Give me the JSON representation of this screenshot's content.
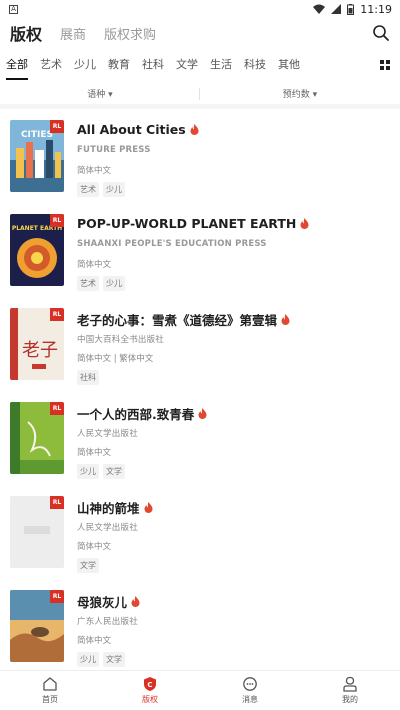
{
  "status_bar": {
    "notification": "A",
    "time": "11:19"
  },
  "top_tabs": [
    {
      "label": "版权",
      "active": true
    },
    {
      "label": "展商",
      "active": false
    },
    {
      "label": "版权求购",
      "active": false
    }
  ],
  "categories": [
    "全部",
    "艺术",
    "少儿",
    "教育",
    "社科",
    "文学",
    "生活",
    "科技",
    "其他"
  ],
  "active_category": "全部",
  "filters": [
    {
      "label": "语种 ▾"
    },
    {
      "label": "预约数 ▾"
    }
  ],
  "badge_text": "RL",
  "books": [
    {
      "title": "All About Cities",
      "publisher": "FUTURE PRESS",
      "lang": "简体中文",
      "tags": [
        "艺术",
        "少儿"
      ]
    },
    {
      "title": "POP-UP-WORLD PLANET EARTH",
      "publisher": "SHAANXI PEOPLE'S EDUCATION PRESS",
      "lang": "简体中文",
      "tags": [
        "艺术",
        "少儿"
      ]
    },
    {
      "title": "老子的心事：雪煮《道德经》第壹辑",
      "publisher": "中国大百科全书出版社",
      "lang": "简体中文 | 繁体中文",
      "tags": [
        "社科"
      ]
    },
    {
      "title": "一个人的西部.致青春",
      "publisher": "人民文学出版社",
      "lang": "简体中文",
      "tags": [
        "少儿",
        "文学"
      ]
    },
    {
      "title": "山神的箭堆",
      "publisher": "人民文学出版社",
      "lang": "简体中文",
      "tags": [
        "文学"
      ]
    },
    {
      "title": "母狼灰儿",
      "publisher": "广东人民出版社",
      "lang": "简体中文",
      "tags": [
        "少儿",
        "文学"
      ]
    }
  ],
  "cover_text": {
    "cities": "CITIES",
    "earth": "PLANET EARTH",
    "laozi": "老子"
  },
  "bottom_nav": [
    {
      "label": "首页",
      "icon": "home-icon",
      "active": false
    },
    {
      "label": "版权",
      "icon": "copyright-icon",
      "active": true
    },
    {
      "label": "消息",
      "icon": "message-icon",
      "active": false
    },
    {
      "label": "我的",
      "icon": "profile-icon",
      "active": false
    }
  ],
  "colors": {
    "accent": "#d93025",
    "text": "#222222",
    "muted": "#888888"
  }
}
